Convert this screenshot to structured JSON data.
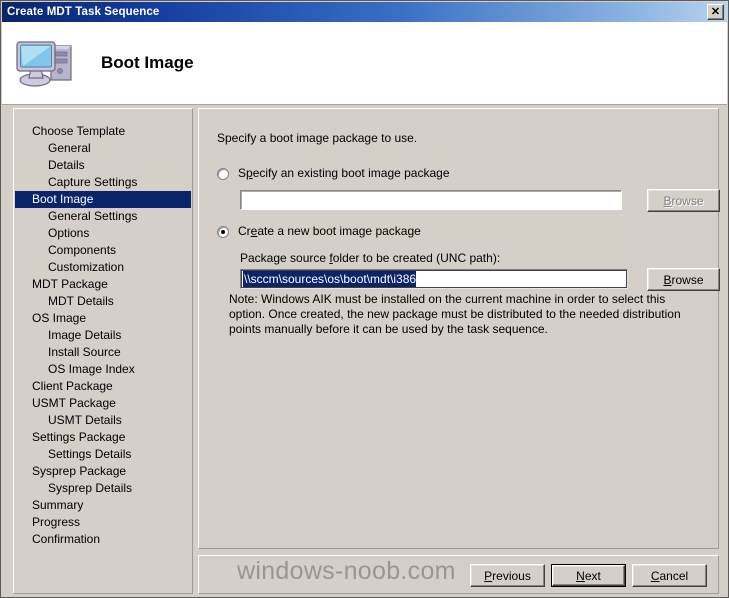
{
  "window": {
    "title": "Create MDT Task Sequence",
    "close_label": "✕",
    "close_icon": "close-icon"
  },
  "header": {
    "title": "Boot Image",
    "icon": "computer-monitor-icon"
  },
  "sidebar": {
    "items": [
      {
        "label": "Choose Template",
        "level": 0,
        "selected": false
      },
      {
        "label": "General",
        "level": 1,
        "selected": false
      },
      {
        "label": "Details",
        "level": 1,
        "selected": false
      },
      {
        "label": "Capture Settings",
        "level": 1,
        "selected": false
      },
      {
        "label": "Boot Image",
        "level": 0,
        "selected": true
      },
      {
        "label": "General Settings",
        "level": 1,
        "selected": false
      },
      {
        "label": "Options",
        "level": 1,
        "selected": false
      },
      {
        "label": "Components",
        "level": 1,
        "selected": false
      },
      {
        "label": "Customization",
        "level": 1,
        "selected": false
      },
      {
        "label": "MDT Package",
        "level": 0,
        "selected": false
      },
      {
        "label": "MDT Details",
        "level": 1,
        "selected": false
      },
      {
        "label": "OS Image",
        "level": 0,
        "selected": false
      },
      {
        "label": "Image Details",
        "level": 1,
        "selected": false
      },
      {
        "label": "Install Source",
        "level": 1,
        "selected": false
      },
      {
        "label": "OS Image Index",
        "level": 1,
        "selected": false
      },
      {
        "label": "Client Package",
        "level": 0,
        "selected": false
      },
      {
        "label": "USMT Package",
        "level": 0,
        "selected": false
      },
      {
        "label": "USMT Details",
        "level": 1,
        "selected": false
      },
      {
        "label": "Settings Package",
        "level": 0,
        "selected": false
      },
      {
        "label": "Settings Details",
        "level": 1,
        "selected": false
      },
      {
        "label": "Sysprep Package",
        "level": 0,
        "selected": false
      },
      {
        "label": "Sysprep Details",
        "level": 1,
        "selected": false
      },
      {
        "label": "Summary",
        "level": 0,
        "selected": false
      },
      {
        "label": "Progress",
        "level": 0,
        "selected": false
      },
      {
        "label": "Confirmation",
        "level": 0,
        "selected": false
      }
    ]
  },
  "content": {
    "prompt": "Specify a boot image package to use.",
    "option_existing": {
      "label_pre": "S",
      "label_acc": "p",
      "label_post": "ecify an existing boot image package",
      "label_full": "Specify an existing boot image package",
      "selected": false,
      "textbox_value": "",
      "textbox_placeholder": "",
      "browse_label_pre": "",
      "browse_label_acc": "B",
      "browse_label_post": "rowse",
      "browse_label_full": "Browse",
      "browse_disabled": true
    },
    "option_new": {
      "label_pre": "Cr",
      "label_acc": "e",
      "label_post": "ate a new boot image package",
      "label_full": "Create a new boot image package",
      "selected": true,
      "field_label_pre": "Package source ",
      "field_label_acc": "f",
      "field_label_post": "older to be created (UNC path):",
      "field_label_full": "Package source folder to be created (UNC path):",
      "textbox_value": "\\\\sccm\\sources\\os\\boot\\mdt\\i386",
      "textbox_selected": true,
      "browse_label_acc": "B",
      "browse_label_post": "rowse",
      "browse_label_full": "Browse"
    },
    "note": "Note: Windows AIK must be installed on the current machine in order to select this option.  Once created, the new package must be distributed to the needed distribution points manually before it can be used by the task sequence."
  },
  "footer": {
    "previous": {
      "acc": "P",
      "post": "revious",
      "full": "Previous"
    },
    "next": {
      "acc": "N",
      "post": "ext",
      "full": "Next",
      "is_default": true
    },
    "cancel": {
      "acc": "C",
      "post": "ancel",
      "full": "Cancel"
    }
  },
  "watermark": {
    "text": "windows-noob.com",
    "color": "#999590"
  },
  "colors": {
    "title_start": "#0a246a",
    "title_end": "#b8d2ee",
    "face": "#d4d0c8",
    "selection": "#0a246a",
    "disabled_text": "#808080"
  }
}
